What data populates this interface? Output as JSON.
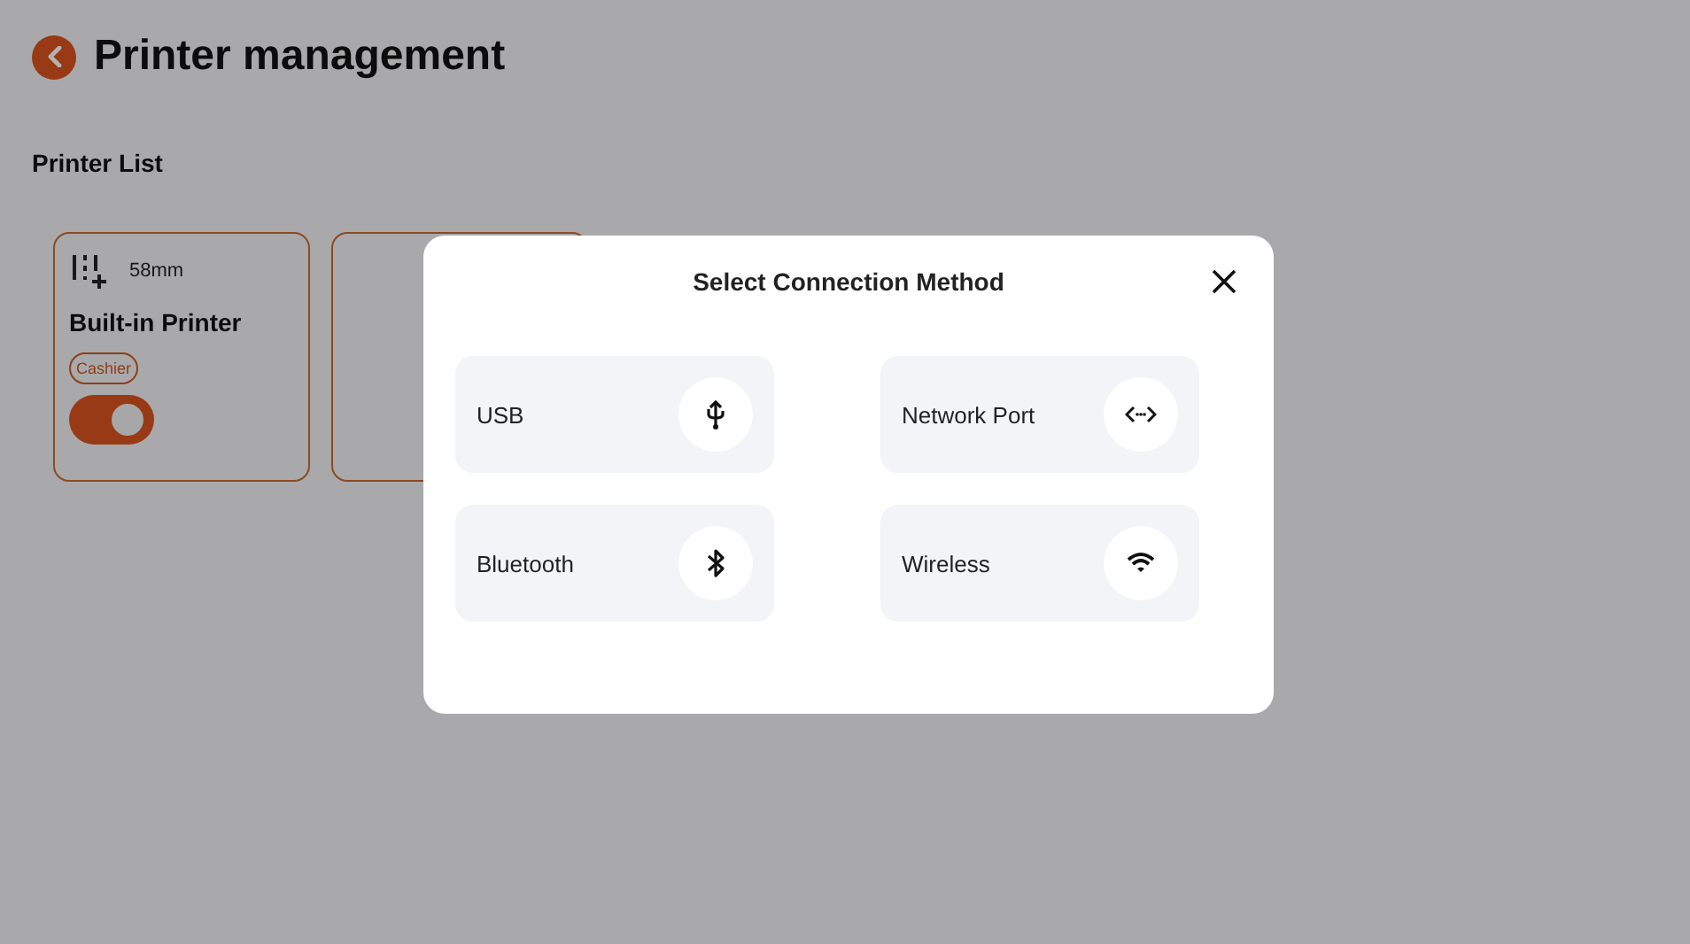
{
  "page": {
    "title": "Printer management"
  },
  "section": {
    "title": "Printer List"
  },
  "printers": [
    {
      "kind": "printer",
      "paper": "58mm",
      "name": "Built-in Printer",
      "tag": "Cashier",
      "on": true
    },
    {
      "kind": "hidden"
    }
  ],
  "dialog": {
    "title": "Select Connection Method",
    "methods": [
      {
        "kind": "usb",
        "label": "USB"
      },
      {
        "kind": "network",
        "label": "Network Port"
      },
      {
        "kind": "bluetooth",
        "label": "Bluetooth"
      },
      {
        "kind": "wireless",
        "label": "Wireless"
      }
    ]
  }
}
